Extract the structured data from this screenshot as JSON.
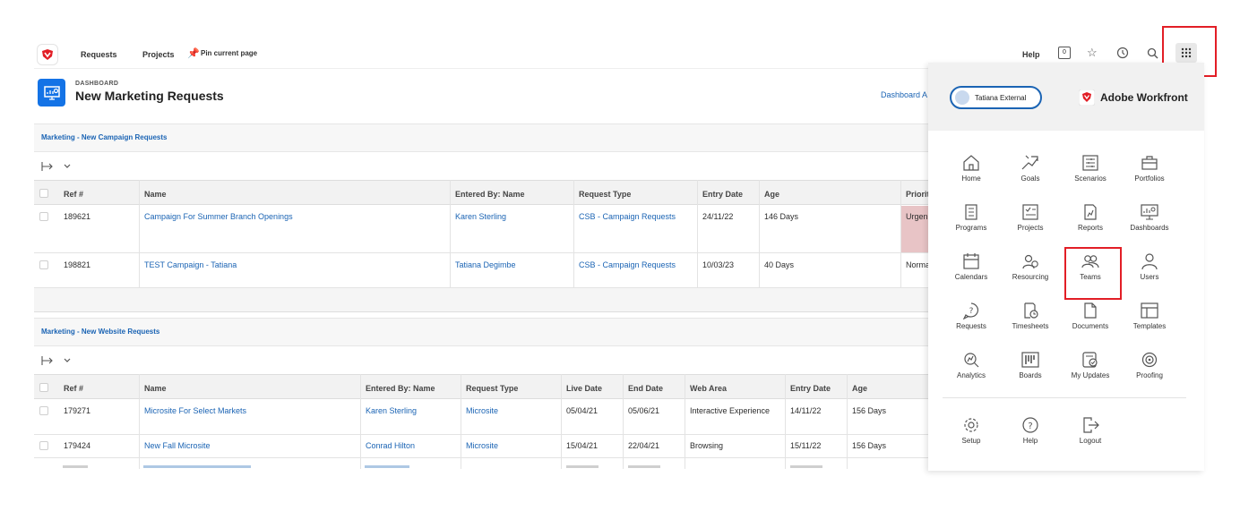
{
  "topnav": {
    "requests": "Requests",
    "projects": "Projects",
    "pin": "Pin current page",
    "help": "Help",
    "count": "0"
  },
  "header": {
    "subtitle": "DASHBOARD",
    "title": "New Marketing Requests",
    "dashboard_link": "Dashboard A"
  },
  "section1": {
    "title": "Marketing - New Campaign Requests",
    "columns": [
      "Ref #",
      "Name",
      "Entered By: Name",
      "Request Type",
      "Entry Date",
      "Age",
      "Priorit"
    ],
    "rows": [
      {
        "ref": "189621",
        "name": "Campaign For Summer Branch Openings",
        "entered_by": "Karen Sterling",
        "type": "CSB - Campaign Requests",
        "entry": "24/11/22",
        "age": "146 Days",
        "priority": "Urgen"
      },
      {
        "ref": "198821",
        "name": "TEST Campaign - Tatiana",
        "entered_by": "Tatiana Degimbe",
        "type": "CSB - Campaign Requests",
        "entry": "10/03/23",
        "age": "40 Days",
        "priority": "Norma"
      }
    ]
  },
  "section2": {
    "title": "Marketing - New Website Requests",
    "columns": [
      "Ref #",
      "Name",
      "Entered By: Name",
      "Request Type",
      "Live Date",
      "End Date",
      "Web Area",
      "Entry Date",
      "Age"
    ],
    "rows": [
      {
        "ref": "179271",
        "name": "Microsite For Select Markets",
        "entered_by": "Karen Sterling",
        "type": "Microsite",
        "live": "05/04/21",
        "end": "05/06/21",
        "area": "Interactive Experience",
        "entry": "14/11/22",
        "age": "156 Days"
      },
      {
        "ref": "179424",
        "name": "New Fall Microsite",
        "entered_by": "Conrad Hilton",
        "type": "Microsite",
        "live": "15/04/21",
        "end": "22/04/21",
        "area": "Browsing",
        "entry": "15/11/22",
        "age": "156 Days"
      }
    ]
  },
  "panel": {
    "user": "Tatiana External",
    "brand": "Adobe Workfront",
    "apps": [
      {
        "label": "Home",
        "icon": "home-icon"
      },
      {
        "label": "Goals",
        "icon": "goals-icon"
      },
      {
        "label": "Scenarios",
        "icon": "scenarios-icon"
      },
      {
        "label": "Portfolios",
        "icon": "portfolios-icon"
      },
      {
        "label": "Programs",
        "icon": "programs-icon"
      },
      {
        "label": "Projects",
        "icon": "projects-icon"
      },
      {
        "label": "Reports",
        "icon": "reports-icon"
      },
      {
        "label": "Dashboards",
        "icon": "dashboards-icon"
      },
      {
        "label": "Calendars",
        "icon": "calendars-icon"
      },
      {
        "label": "Resourcing",
        "icon": "resourcing-icon"
      },
      {
        "label": "Teams",
        "icon": "teams-icon"
      },
      {
        "label": "Users",
        "icon": "users-icon"
      },
      {
        "label": "Requests",
        "icon": "requests-icon"
      },
      {
        "label": "Timesheets",
        "icon": "timesheets-icon"
      },
      {
        "label": "Documents",
        "icon": "documents-icon"
      },
      {
        "label": "Templates",
        "icon": "templates-icon"
      },
      {
        "label": "Analytics",
        "icon": "analytics-icon"
      },
      {
        "label": "Boards",
        "icon": "boards-icon"
      },
      {
        "label": "My Updates",
        "icon": "my-updates-icon"
      },
      {
        "label": "Proofing",
        "icon": "proofing-icon"
      }
    ],
    "footer": [
      {
        "label": "Setup",
        "icon": "setup-icon"
      },
      {
        "label": "Help",
        "icon": "help-icon"
      },
      {
        "label": "Logout",
        "icon": "logout-icon"
      }
    ]
  },
  "colors": {
    "accent": "#1b64b4",
    "brand_red": "#e21e26",
    "urgent_bg": "#e8c4c6"
  }
}
